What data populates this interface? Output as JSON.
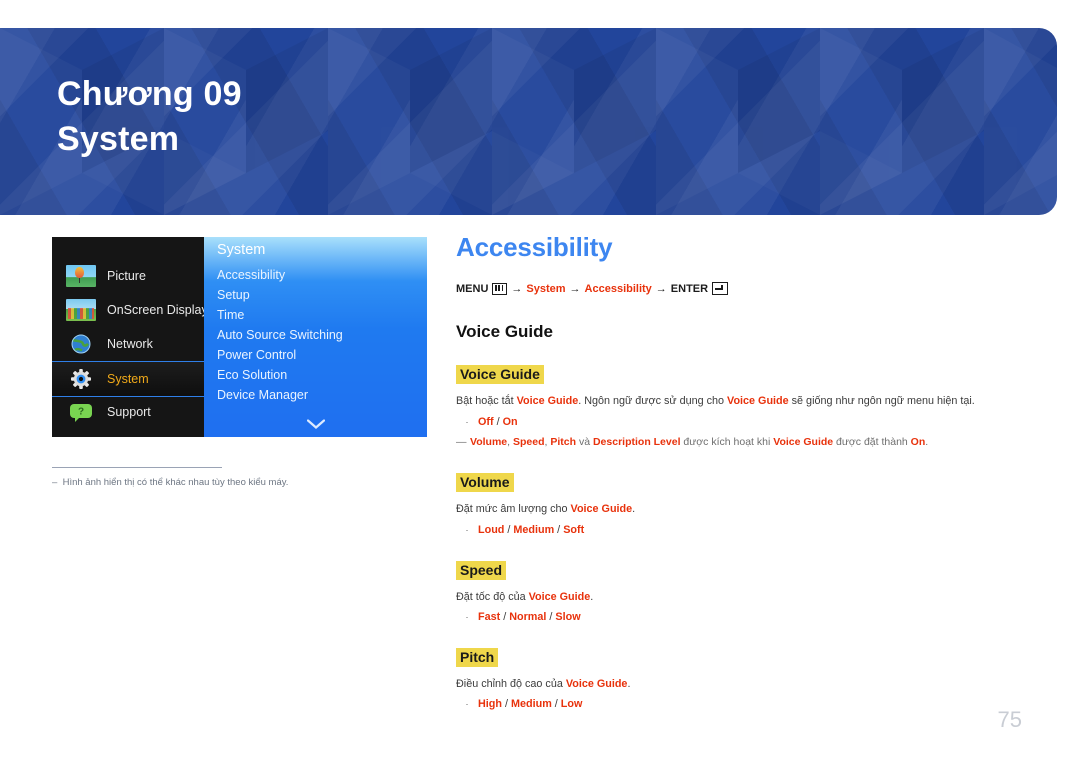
{
  "banner": {
    "chapter_line1": "Chương 09",
    "chapter_line2": "System",
    "bg_color": "#22459b"
  },
  "osd": {
    "left_menu": [
      {
        "label": "Picture",
        "icon": "picture-thumbnail-icon",
        "selected": false
      },
      {
        "label": "OnScreen Display",
        "icon": "onscreen-display-thumbnail-icon",
        "selected": false
      },
      {
        "label": "Network",
        "icon": "globe-icon",
        "selected": false
      },
      {
        "label": "System",
        "icon": "gear-icon",
        "selected": true
      },
      {
        "label": "Support",
        "icon": "support-bubble-icon",
        "selected": false
      }
    ],
    "panel_title": "System",
    "panel_items": [
      "Accessibility",
      "Setup",
      "Time",
      "Auto Source Switching",
      "Power Control",
      "Eco Solution",
      "Device Manager"
    ],
    "scroll_icon": "chevron-down-icon",
    "selected_label_color": "#f0a919",
    "note": "Hình ảnh hiển thị có thể khác nhau tùy theo kiểu máy.",
    "note_marker": "–"
  },
  "content": {
    "title": "Accessibility",
    "title_color": "#3d86f0",
    "breadcrumb": {
      "menu_label": "MENU",
      "menu_icon": "menu-keypad-icon",
      "arrow": "→",
      "step1": "System",
      "step2": "Accessibility",
      "enter_label": "ENTER",
      "enter_icon": "enter-key-icon",
      "accent_color": "#e8320c"
    },
    "section_heading": "Voice Guide",
    "blocks": [
      {
        "name": "voice-guide",
        "highlight": "Voice Guide",
        "desc_parts": [
          {
            "t": "Bật hoặc tắt ",
            "red": false
          },
          {
            "t": "Voice Guide",
            "red": true
          },
          {
            "t": ". Ngôn ngữ được sử dụng cho ",
            "red": false
          },
          {
            "t": "Voice Guide",
            "red": true
          },
          {
            "t": " sẽ giống như ngôn ngữ menu hiện tại.",
            "red": false
          }
        ],
        "options": [
          "Off",
          "On"
        ],
        "note_parts": [
          {
            "t": "Volume",
            "red": true
          },
          {
            "t": ", ",
            "red": false
          },
          {
            "t": "Speed",
            "red": true
          },
          {
            "t": ", ",
            "red": false
          },
          {
            "t": "Pitch",
            "red": true
          },
          {
            "t": " và ",
            "red": false
          },
          {
            "t": "Description Level",
            "red": true
          },
          {
            "t": " được kích hoạt khi ",
            "red": false
          },
          {
            "t": "Voice Guide",
            "red": true
          },
          {
            "t": " được đặt thành ",
            "red": false
          },
          {
            "t": "On",
            "red": true
          },
          {
            "t": ".",
            "red": false
          }
        ]
      },
      {
        "name": "volume",
        "highlight": "Volume",
        "desc_parts": [
          {
            "t": "Đặt mức âm lượng cho ",
            "red": false
          },
          {
            "t": "Voice Guide",
            "red": true
          },
          {
            "t": ".",
            "red": false
          }
        ],
        "options": [
          "Loud",
          "Medium",
          "Soft"
        ],
        "note_parts": []
      },
      {
        "name": "speed",
        "highlight": "Speed",
        "desc_parts": [
          {
            "t": "Đặt tốc độ của ",
            "red": false
          },
          {
            "t": "Voice Guide",
            "red": true
          },
          {
            "t": ".",
            "red": false
          }
        ],
        "options": [
          "Fast",
          "Normal",
          "Slow"
        ],
        "note_parts": []
      },
      {
        "name": "pitch",
        "highlight": "Pitch",
        "desc_parts": [
          {
            "t": "Điều chỉnh độ cao của ",
            "red": false
          },
          {
            "t": "Voice Guide",
            "red": true
          },
          {
            "t": ".",
            "red": false
          }
        ],
        "options": [
          "High",
          "Medium",
          "Low"
        ],
        "note_parts": []
      }
    ],
    "bullet_glyph": "·",
    "note_dash": "―",
    "option_separator": "/",
    "highlight_color": "#efd74b"
  },
  "page_number": "75"
}
